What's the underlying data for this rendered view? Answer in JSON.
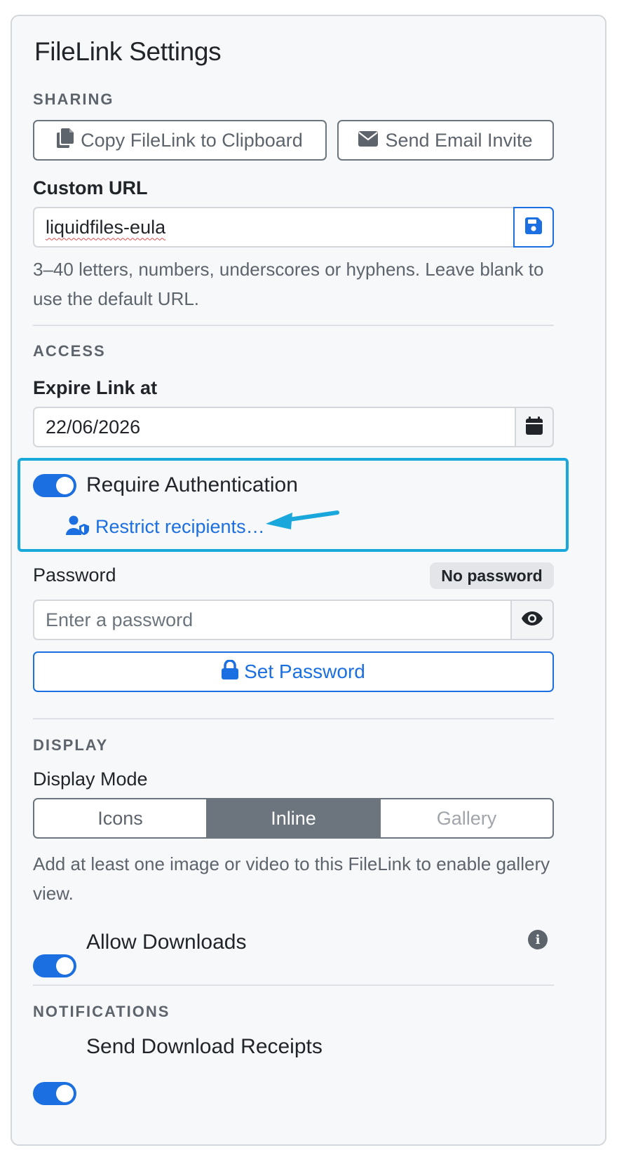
{
  "panel": {
    "title": "FileLink Settings"
  },
  "sharing": {
    "section_label": "SHARING",
    "copy_button": "Copy FileLink to Clipboard",
    "email_button": "Send Email Invite",
    "custom_url_label": "Custom URL",
    "custom_url_value": "liquidfiles-eula",
    "custom_url_help": "3–40 letters, numbers, underscores or hyphens. Leave blank to use the default URL."
  },
  "access": {
    "section_label": "ACCESS",
    "expire_label": "Expire Link at",
    "expire_value": "22/06/2026",
    "require_auth_label": "Require Authentication",
    "require_auth_enabled": true,
    "restrict_link": "Restrict recipients…",
    "password_label": "Password",
    "password_badge": "No password",
    "password_placeholder": "Enter a password",
    "set_password_button": "Set Password"
  },
  "display": {
    "section_label": "DISPLAY",
    "mode_label": "Display Mode",
    "modes": [
      "Icons",
      "Inline",
      "Gallery"
    ],
    "selected_mode": "Inline",
    "gallery_help": "Add at least one image or video to this FileLink to enable gallery view.",
    "allow_downloads_label": "Allow Downloads",
    "allow_downloads_enabled": true
  },
  "notifications": {
    "section_label": "NOTIFICATIONS",
    "receipts_label": "Send Download Receipts",
    "receipts_enabled": true
  },
  "colors": {
    "primary": "#1b6fe0",
    "highlight": "#1aa8dc",
    "secondary": "#6c757d"
  },
  "icons": [
    "copy-icon",
    "envelope-icon",
    "save-icon",
    "calendar-icon",
    "user-shield-icon",
    "arrow-icon",
    "eye-icon",
    "lock-icon",
    "info-icon"
  ]
}
